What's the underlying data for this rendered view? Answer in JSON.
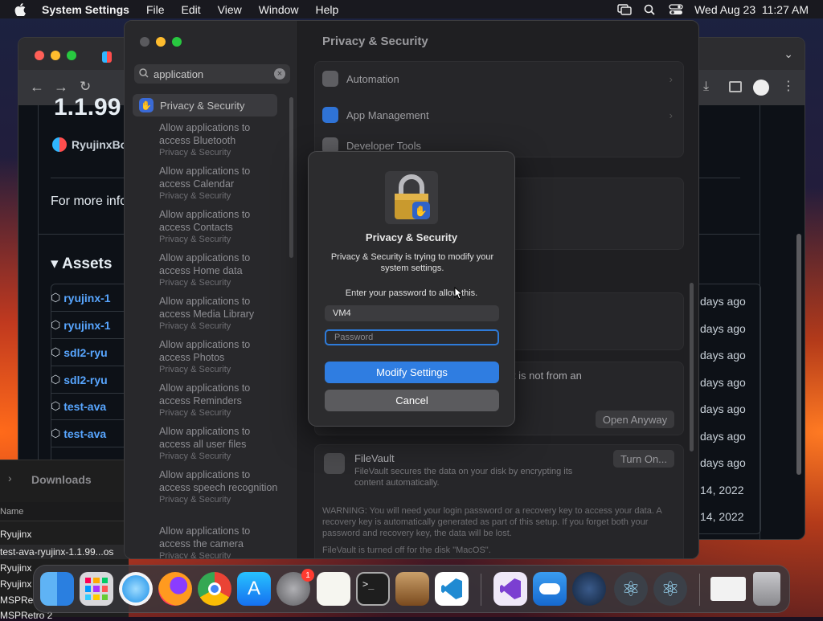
{
  "menubar": {
    "app_name": "System Settings",
    "items": [
      "File",
      "Edit",
      "View",
      "Window",
      "Help"
    ],
    "clock": "Wed Aug 23  11:27 AM"
  },
  "browser": {
    "version_fragment": "1.1.99",
    "author": "RyujinxBo",
    "info_text": "For more info",
    "assets_heading": "Assets",
    "assets": [
      "ryujinx-1",
      "ryujinx-1",
      "sdl2-ryu",
      "sdl2-ryu",
      "test-ava",
      "test-ava"
    ],
    "ages": [
      "days ago",
      "days ago",
      "days ago",
      "days ago",
      "days ago",
      "days ago",
      "days ago",
      "14, 2022",
      "14, 2022"
    ]
  },
  "downloads": {
    "title": "Downloads",
    "column_name": "Name",
    "files": [
      "Ryujinx",
      "test-ava-ryujinx-1.1.99...os",
      "Ryujinx",
      "Ryujinx",
      "MSPRe",
      "MSPRetro 2"
    ]
  },
  "settings": {
    "search_value": "application",
    "sidebar_selected": "Privacy & Security",
    "results": [
      {
        "label": "Allow applications to access Bluetooth",
        "sub": "Privacy & Security"
      },
      {
        "label": "Allow applications to access Calendar",
        "sub": "Privacy & Security"
      },
      {
        "label": "Allow applications to access Contacts",
        "sub": "Privacy & Security"
      },
      {
        "label": "Allow applications to access Home data",
        "sub": "Privacy & Security"
      },
      {
        "label": "Allow applications to access Media Library",
        "sub": "Privacy & Security"
      },
      {
        "label": "Allow applications to access Photos",
        "sub": "Privacy & Security"
      },
      {
        "label": "Allow applications to access Reminders",
        "sub": "Privacy & Security"
      },
      {
        "label": "Allow applications to access all user files",
        "sub": "Privacy & Security"
      },
      {
        "label": "Allow applications to access speech recognition",
        "sub": "Privacy & Security"
      },
      {
        "label": "Allow applications to access the camera",
        "sub": "Privacy & Security"
      }
    ],
    "main_title": "Privacy & Security",
    "rows": [
      "Automation",
      "App Management",
      "Developer Tools"
    ],
    "gatekeeper_fragment": "it is not from an",
    "open_anyway": "Open Anyway",
    "filevault": {
      "title": "FileVault",
      "desc": "FileVault secures the data on your disk by encrypting its content automatically.",
      "button": "Turn On...",
      "warning": "WARNING: You will need your login password or a recovery key to access your data. A recovery key is automatically generated as part of this setup. If you forget both your password and recovery key, the data will be lost.",
      "status": "FileVault is turned off for the disk \"MacOS\"."
    }
  },
  "dialog": {
    "title": "Privacy & Security",
    "message": "Privacy & Security is trying to modify your system settings.",
    "prompt": "Enter your password to allow this.",
    "username": "VM4",
    "password_placeholder": "Password",
    "primary_button": "Modify Settings",
    "cancel_button": "Cancel"
  },
  "dock": {
    "badge_count": "1"
  }
}
